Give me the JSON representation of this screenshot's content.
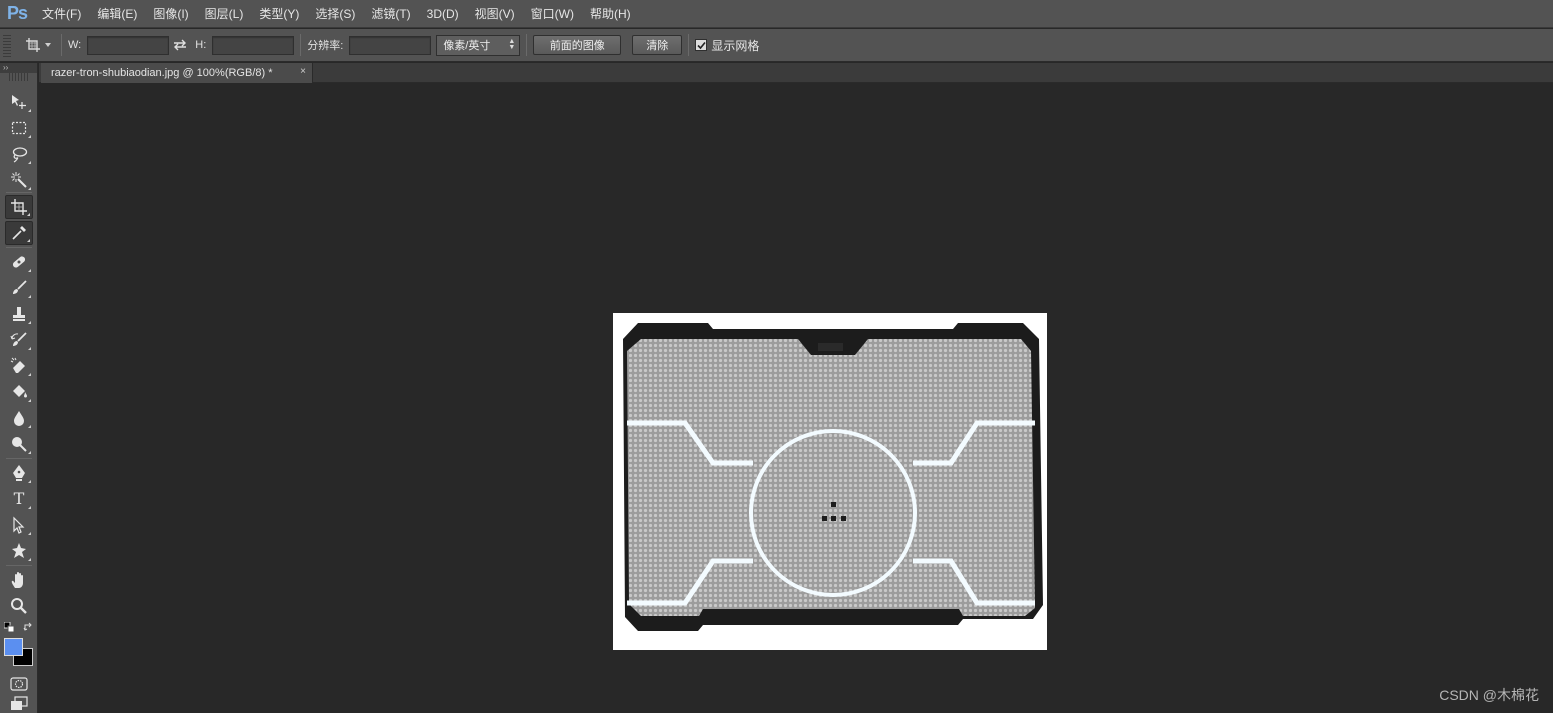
{
  "app": {
    "logo": "Ps"
  },
  "menu": [
    {
      "label": "文件(F)"
    },
    {
      "label": "编辑(E)"
    },
    {
      "label": "图像(I)"
    },
    {
      "label": "图层(L)"
    },
    {
      "label": "类型(Y)"
    },
    {
      "label": "选择(S)"
    },
    {
      "label": "滤镜(T)"
    },
    {
      "label": "3D(D)"
    },
    {
      "label": "视图(V)"
    },
    {
      "label": "窗口(W)"
    },
    {
      "label": "帮助(H)"
    }
  ],
  "options": {
    "width_label": "W:",
    "width_value": "",
    "height_label": "H:",
    "height_value": "",
    "resolution_label": "分辨率:",
    "resolution_value": "",
    "unit_select": "像素/英寸",
    "front_image_button": "前面的图像",
    "clear_button": "清除",
    "show_grid_label": "显示网格",
    "show_grid_checked": true
  },
  "toolbox": {
    "collapse_label": "››",
    "tools": [
      {
        "icon": "move-tool-icon"
      },
      {
        "icon": "marquee-tool-icon"
      },
      {
        "icon": "lasso-tool-icon"
      },
      {
        "icon": "magic-wand-tool-icon"
      },
      {
        "icon": "crop-tool-icon",
        "active": true
      },
      {
        "icon": "eyedropper-tool-icon",
        "active": true
      },
      {
        "icon": "healing-brush-tool-icon"
      },
      {
        "icon": "brush-tool-icon"
      },
      {
        "icon": "clone-stamp-tool-icon"
      },
      {
        "icon": "history-brush-tool-icon"
      },
      {
        "icon": "eraser-tool-icon"
      },
      {
        "icon": "paint-bucket-tool-icon"
      },
      {
        "icon": "blur-tool-icon"
      },
      {
        "icon": "dodge-tool-icon"
      },
      {
        "icon": "pen-tool-icon"
      },
      {
        "icon": "type-tool-icon"
      },
      {
        "icon": "path-selection-tool-icon"
      },
      {
        "icon": "custom-shape-tool-icon"
      },
      {
        "icon": "hand-tool-icon"
      },
      {
        "icon": "zoom-tool-icon"
      }
    ],
    "foreground_color": "#5b8ff0",
    "background_color": "#000000",
    "type_tool_text": "T"
  },
  "document": {
    "tab_title": "razer-tron-shubiaodian.jpg @ 100%(RGB/8) *",
    "tab_close": "×"
  },
  "watermark": "CSDN @木棉花"
}
